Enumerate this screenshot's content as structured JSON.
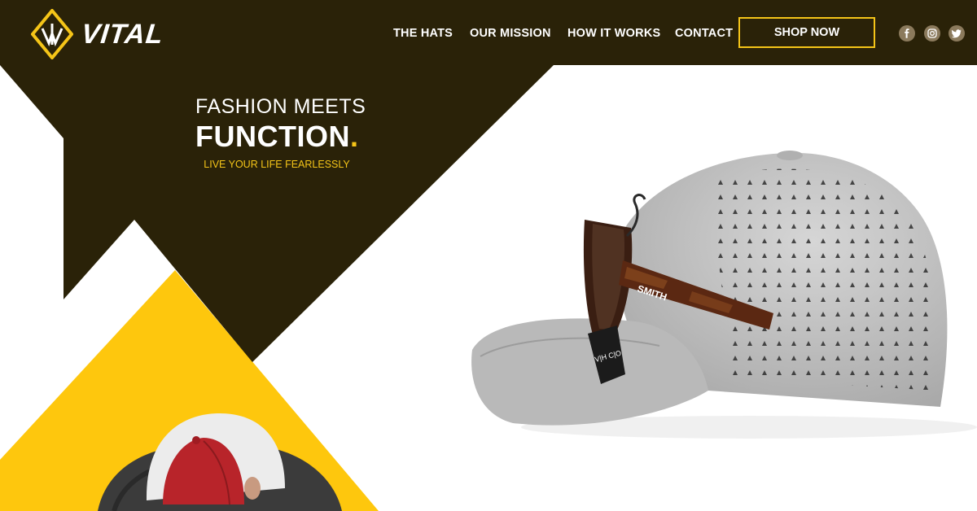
{
  "brand": {
    "name": "VITAL"
  },
  "nav": {
    "links": [
      "THE HATS",
      "OUR MISSION",
      "HOW IT WORKS",
      "CONTACT"
    ],
    "shop_label": "SHOP NOW"
  },
  "social": [
    "facebook-icon",
    "instagram-icon",
    "twitter-icon"
  ],
  "hero": {
    "line1": "FASHION MEETS",
    "line2": "FUNCTION",
    "line2_dot": ".",
    "tagline": "LIVE YOUR LIFE FEARLESSLY"
  },
  "product": {
    "sunglasses_brand": "SMITH",
    "tag_text": "V|H C|O"
  },
  "colors": {
    "dark_brown": "#2a2208",
    "accent_yellow": "#f5c518",
    "social_bg": "#8b7a5c",
    "hat_gray": "#c4c4c4"
  }
}
